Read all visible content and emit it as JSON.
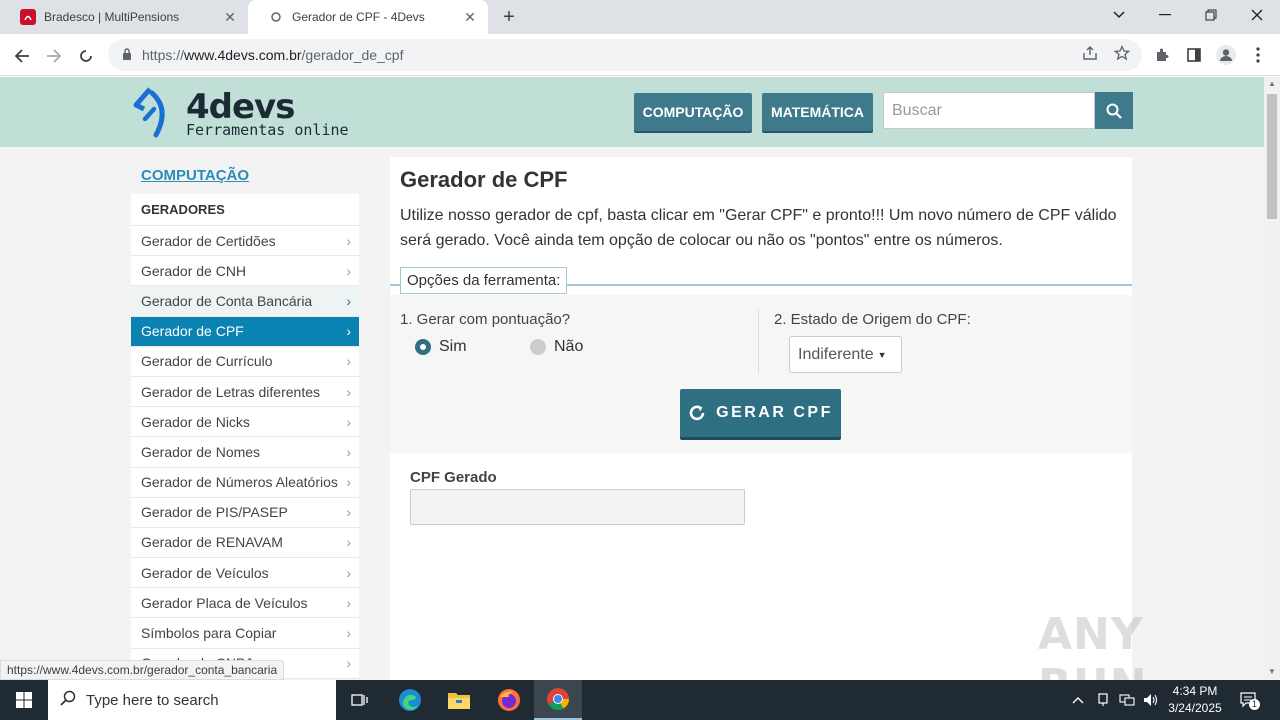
{
  "browser": {
    "tabs": [
      {
        "title": "Bradesco | MultiPensions",
        "active": false
      },
      {
        "title": "Gerador de CPF - 4Devs",
        "active": true
      }
    ],
    "url_prefix": "https://",
    "url_domain": "www.4devs.com.br",
    "url_path": "/gerador_de_cpf",
    "status_url": "https://www.4devs.com.br/gerador_conta_bancaria"
  },
  "header": {
    "logo_main": "4devs",
    "logo_sub": "Ferramentas online",
    "nav_computacao": "COMPUTAÇÃO",
    "nav_matematica": "MATEMÁTICA",
    "search_placeholder": "Buscar"
  },
  "sidebar": {
    "category": "COMPUTAÇÃO",
    "section": "GERADORES",
    "items": [
      {
        "label": "Gerador de Certidões",
        "state": "normal"
      },
      {
        "label": "Gerador de CNH",
        "state": "normal"
      },
      {
        "label": "Gerador de Conta Bancária",
        "state": "hover"
      },
      {
        "label": "Gerador de CPF",
        "state": "active"
      },
      {
        "label": "Gerador de Currículo",
        "state": "normal"
      },
      {
        "label": "Gerador de Letras diferentes",
        "state": "normal"
      },
      {
        "label": "Gerador de Nicks",
        "state": "normal"
      },
      {
        "label": "Gerador de Nomes",
        "state": "normal"
      },
      {
        "label": "Gerador de Números Aleatórios",
        "state": "normal"
      },
      {
        "label": "Gerador de PIS/PASEP",
        "state": "normal"
      },
      {
        "label": "Gerador de RENAVAM",
        "state": "normal"
      },
      {
        "label": "Gerador de Veículos",
        "state": "normal"
      },
      {
        "label": "Gerador Placa de Veículos",
        "state": "normal"
      },
      {
        "label": "Símbolos para Copiar",
        "state": "normal"
      },
      {
        "label": "Gerador de CNPJ",
        "state": "normal"
      }
    ]
  },
  "main": {
    "title": "Gerador de CPF",
    "description": "Utilize nosso gerador de cpf, basta clicar em \"Gerar CPF\" e pronto!!! Um novo número de CPF válido será gerado. Você ainda tem opção de colocar ou não os \"pontos\" entre os números.",
    "options_legend": "Opções da ferramenta:",
    "option1_label": "1. Gerar com pontuação?",
    "radio_sim": "Sim",
    "radio_nao": "Não",
    "radio_selected": "Sim",
    "option2_label": "2. Estado de Origem do CPF:",
    "estado_value": "Indiferente",
    "generate_button": "GERAR CPF",
    "output_label": "CPF Gerado",
    "output_value": ""
  },
  "watermark": "ANY RUN",
  "taskbar": {
    "search_placeholder": "Type here to search",
    "time": "4:34 PM",
    "date": "3/24/2025",
    "notification_count": "1"
  }
}
